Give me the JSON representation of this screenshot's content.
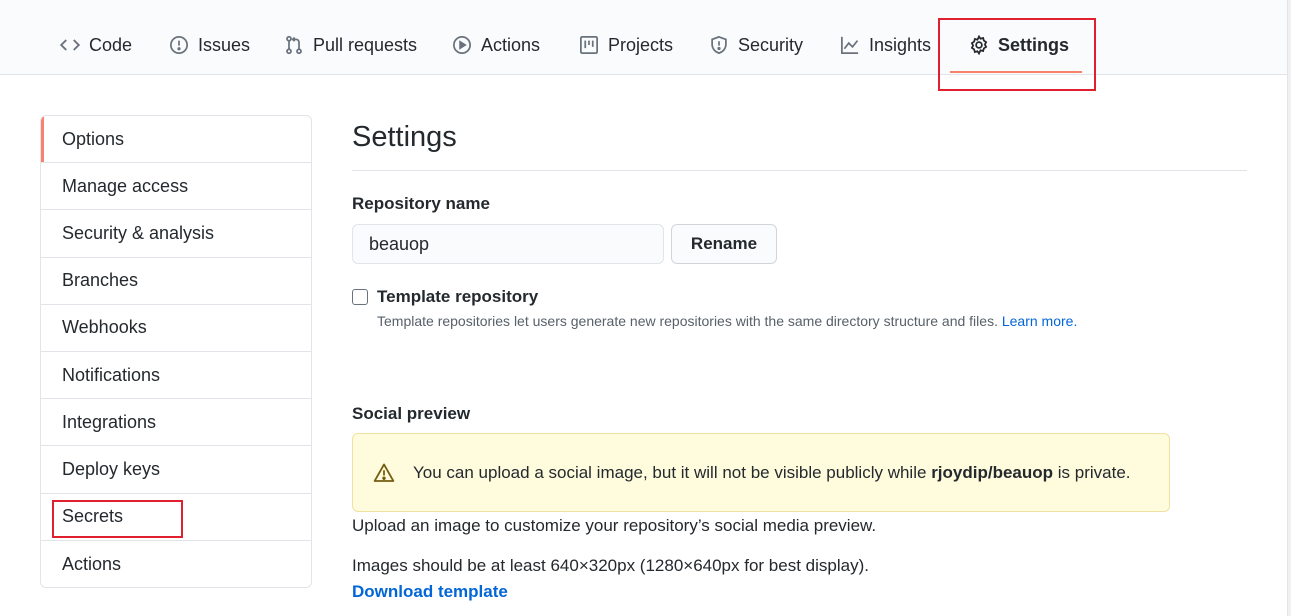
{
  "nav": {
    "tabs": [
      {
        "label": "Code",
        "icon": "code-icon"
      },
      {
        "label": "Issues",
        "icon": "issue-icon"
      },
      {
        "label": "Pull requests",
        "icon": "pull-request-icon"
      },
      {
        "label": "Actions",
        "icon": "play-icon"
      },
      {
        "label": "Projects",
        "icon": "project-icon"
      },
      {
        "label": "Security",
        "icon": "shield-icon"
      },
      {
        "label": "Insights",
        "icon": "graph-icon"
      },
      {
        "label": "Settings",
        "icon": "gear-icon",
        "selected": true
      }
    ]
  },
  "sidebar": {
    "items": [
      {
        "label": "Options",
        "selected": true
      },
      {
        "label": "Manage access"
      },
      {
        "label": "Security & analysis"
      },
      {
        "label": "Branches"
      },
      {
        "label": "Webhooks"
      },
      {
        "label": "Notifications"
      },
      {
        "label": "Integrations"
      },
      {
        "label": "Deploy keys"
      },
      {
        "label": "Secrets"
      },
      {
        "label": "Actions"
      }
    ]
  },
  "main": {
    "title": "Settings",
    "repo_name_label": "Repository name",
    "repo_name_value": "beauop",
    "rename_button": "Rename",
    "template_label": "Template repository",
    "template_desc": "Template repositories let users generate new repositories with the same directory structure and files.",
    "learn_more": "Learn more.",
    "social_label": "Social preview",
    "flash": {
      "prefix": "You can upload a social image, but it will not be visible publicly while",
      "repo": "rjoydip/beauop",
      "suffix": "is private."
    },
    "upload_text": "Upload an image to customize your repository’s social media preview.",
    "size_text": "Images should be at least 640×320px (1280×640px for best display).",
    "download_template": "Download template"
  },
  "colors": {
    "accent_underline": "#f9826c",
    "highlight_box": "#e0202f",
    "link": "#0366d6",
    "flash_bg": "#fffbdd"
  }
}
